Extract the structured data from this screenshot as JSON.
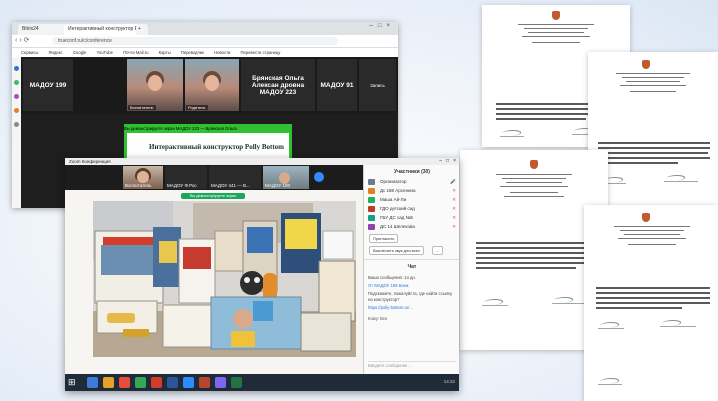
{
  "browser": {
    "tabs": [
      {
        "label": "Bitrix24"
      },
      {
        "label": "Интерактивный конструктор Polly"
      },
      {
        "label": "+"
      }
    ],
    "url": "trueconf.ru/c/conference",
    "bookmarks": [
      "Сервисы",
      "Яндекс",
      "Google",
      "YouTube",
      "Почта Mail.ru",
      "Карты",
      "Переводчик",
      "Новости",
      "Перевести страницу"
    ],
    "meeting": {
      "tiles": [
        {
          "name": "МАДОУ 199"
        },
        {
          "name": "Воспитатель"
        },
        {
          "name": "Родитель"
        },
        {
          "name": "Брянская Ольга Алексан дровна МАДОУ 223"
        },
        {
          "name": "МАДОУ 91"
        }
      ],
      "record_label": "Запись",
      "share_strip": "Вы демонстрируете экран  МАДОУ 223 — Брянская Ольга",
      "slide_title": "Интерактивный конструктор Polly Bottom"
    }
  },
  "zoom": {
    "title": "Zoom Конференция",
    "strip_tiles": [
      {
        "name": "Воспитатель"
      },
      {
        "name": "МАДОУ Ф.Рос"
      },
      {
        "name": "МАДОУ 441 — В..."
      },
      {
        "name": "МАДОУ 100"
      }
    ],
    "share_label": "Вы демонстрируете экран",
    "taskbar_time": "14:32",
    "participants": {
      "header": "Участники (30)",
      "rows": [
        {
          "name": "Организатор"
        },
        {
          "name": "Дс 188 Арсенина"
        },
        {
          "name": "Маша Ай-Ли"
        },
        {
          "name": "ГДО детский сад"
        },
        {
          "name": "ГБУ ДС сад №5"
        },
        {
          "name": "ДС 14 Шелехова"
        }
      ],
      "buttons": [
        "Пригласить",
        "Выключить звук для всех",
        "..."
      ]
    },
    "chat": {
      "header": "Чат",
      "messages": [
        "Ваши сообщения: 14 дн.",
        "От МАДОУ 199 всем:",
        "Подскажите, пожалуйста, где найти ссылку на конструктор?",
        "https://polly-bottom.ru/..."
      ],
      "input_placeholder": "Введите сообщение…",
      "to_label": "Кому: Все"
    }
  }
}
